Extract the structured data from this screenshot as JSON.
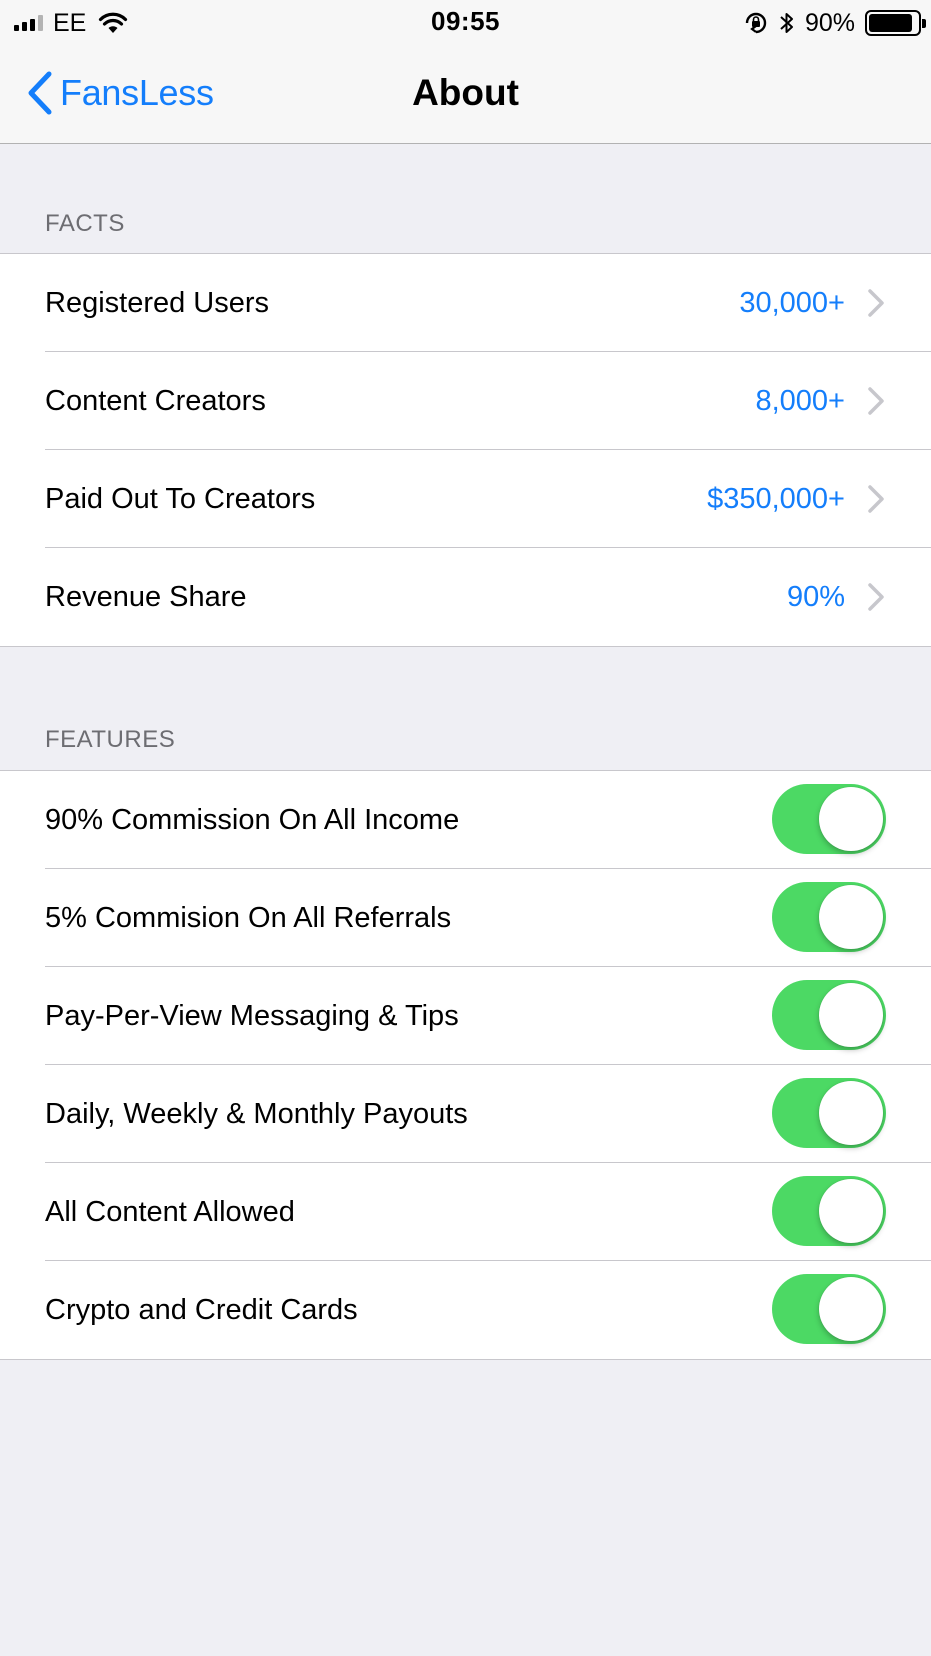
{
  "status_bar": {
    "carrier": "EE",
    "time": "09:55",
    "battery_percent": "90%",
    "battery_level": 0.9
  },
  "nav": {
    "back_label": "FansLess",
    "title": "About"
  },
  "facts": {
    "header": "FACTS",
    "rows": [
      {
        "label": "Registered Users",
        "value": "30,000+"
      },
      {
        "label": "Content Creators",
        "value": "8,000+"
      },
      {
        "label": "Paid Out To Creators",
        "value": "$350,000+"
      },
      {
        "label": "Revenue Share",
        "value": "90%"
      }
    ]
  },
  "features": {
    "header": "FEATURES",
    "rows": [
      {
        "label": "90% Commission On All Income",
        "enabled": true
      },
      {
        "label": "5% Commision On All Referrals",
        "enabled": true
      },
      {
        "label": "Pay-Per-View Messaging & Tips",
        "enabled": true
      },
      {
        "label": "Daily, Weekly & Monthly Payouts",
        "enabled": true
      },
      {
        "label": "All Content Allowed",
        "enabled": true
      },
      {
        "label": "Crypto and Credit Cards",
        "enabled": true
      }
    ]
  },
  "colors": {
    "accent": "#147efb",
    "toggle_on": "#4cd964",
    "background": "#efeff4"
  }
}
